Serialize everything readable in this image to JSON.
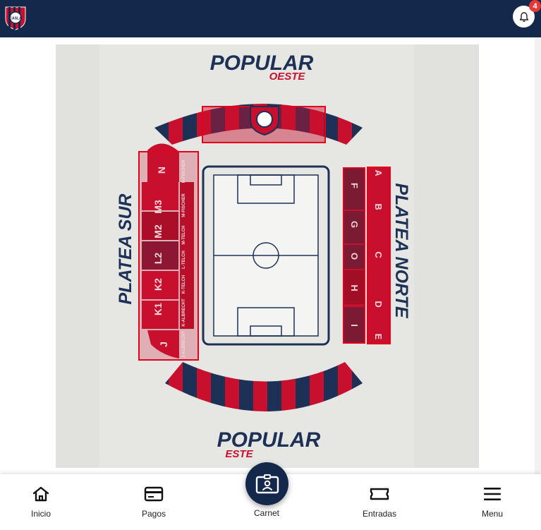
{
  "header": {
    "logo_text": "CASLA",
    "notification_count": "4"
  },
  "colors": {
    "navy": "#13284b",
    "red": "#c8102e",
    "badge": "#e53935"
  },
  "stadium_map": {
    "stands": {
      "popular_oeste": {
        "title": "POPULAR",
        "subtitle": "OESTE"
      },
      "popular_este": {
        "title": "POPULAR",
        "subtitle": "ESTE"
      },
      "platea_sur": "PLATEA SUR",
      "platea_norte": "PLATEA NORTE"
    },
    "sur_sections": [
      "N",
      "M3",
      "M2",
      "L2",
      "K2",
      "K1",
      "J"
    ],
    "sur_sublabels": [
      "N-FISCHER",
      "M-FISCHER",
      "M-TELCH",
      "L-TELCH",
      "K-TELCH",
      "K-ALBRECHT",
      "J-ALBRECHT"
    ],
    "norte_inner": [
      "F",
      "G",
      "O",
      "H",
      "I"
    ],
    "norte_outer": [
      "A",
      "B",
      "C",
      "D",
      "E"
    ]
  },
  "bottom_nav": {
    "inicio": "Inicio",
    "pagos": "Pagos",
    "carnet": "Carnet",
    "entradas": "Entradas",
    "menu": "Menu"
  }
}
